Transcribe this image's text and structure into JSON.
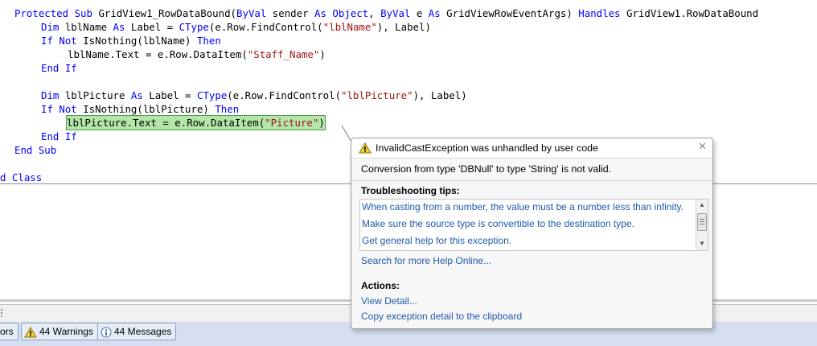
{
  "code": {
    "line1": {
      "kw1": "Protected Sub",
      "t1": " GridView1_RowDataBound(",
      "kw2": "ByVal",
      "t2": " sender ",
      "kw3": "As Object",
      "t3": ", ",
      "kw4": "ByVal",
      "t4": " e ",
      "kw5": "As",
      "t5": " GridViewRowEventArgs) ",
      "kw6": "Handles",
      "t6": " GridView1.RowDataBound"
    },
    "line2": {
      "kw1": "Dim",
      "t1": " lblName ",
      "kw2": "As",
      "t2": " Label = ",
      "kw3": "CType",
      "t3": "(e.Row.FindControl(",
      "s1": "\"lblName\"",
      "t4": "), Label)"
    },
    "line3": {
      "kw1": "If Not",
      "t1": " IsNothing(lblName) ",
      "kw2": "Then"
    },
    "line4": {
      "t1": "lblName.Text = e.Row.DataItem(",
      "s1": "\"Staff_Name\"",
      "t2": ")"
    },
    "line5": {
      "kw1": "End If"
    },
    "line7": {
      "kw1": "Dim",
      "t1": " lblPicture ",
      "kw2": "As",
      "t2": " Label = ",
      "kw3": "CType",
      "t3": "(e.Row.FindControl(",
      "s1": "\"lblPicture\"",
      "t4": "), Label)"
    },
    "line8": {
      "kw1": "If Not",
      "t1": " IsNothing(lblPicture) ",
      "kw2": "Then"
    },
    "line9": {
      "t1": "lblPicture.Text = e.Row.DataItem(",
      "s1": "\"Picture\"",
      "t2": ")"
    },
    "line10": {
      "kw1": "End If"
    },
    "line11": {
      "kw1": "End Sub"
    },
    "line13": {
      "kw1": "d Class"
    }
  },
  "exception_helper": {
    "title": "InvalidCastException was unhandled by user code",
    "message": "Conversion from type 'DBNull' to type 'String' is not valid.",
    "tips_heading": "Troubleshooting tips:",
    "tips": [
      "When casting from a number, the value must be a number less than infinity.",
      "Make sure the source type is convertible to the destination type.",
      "Get general help for this exception."
    ],
    "search_link": "Search for more Help Online...",
    "actions_heading": "Actions:",
    "actions": [
      "View Detail...",
      "Copy exception detail to the clipboard"
    ],
    "icon": "warning-icon",
    "close_icon": "close-icon"
  },
  "error_list_toolbar": {
    "errors_label": "ors",
    "warnings_label": "44 Warnings",
    "messages_label": "44 Messages"
  },
  "colors": {
    "keyword": "#0000ff",
    "string": "#a31515",
    "highlight": "#b4e6a9",
    "link": "#1e5bab"
  }
}
